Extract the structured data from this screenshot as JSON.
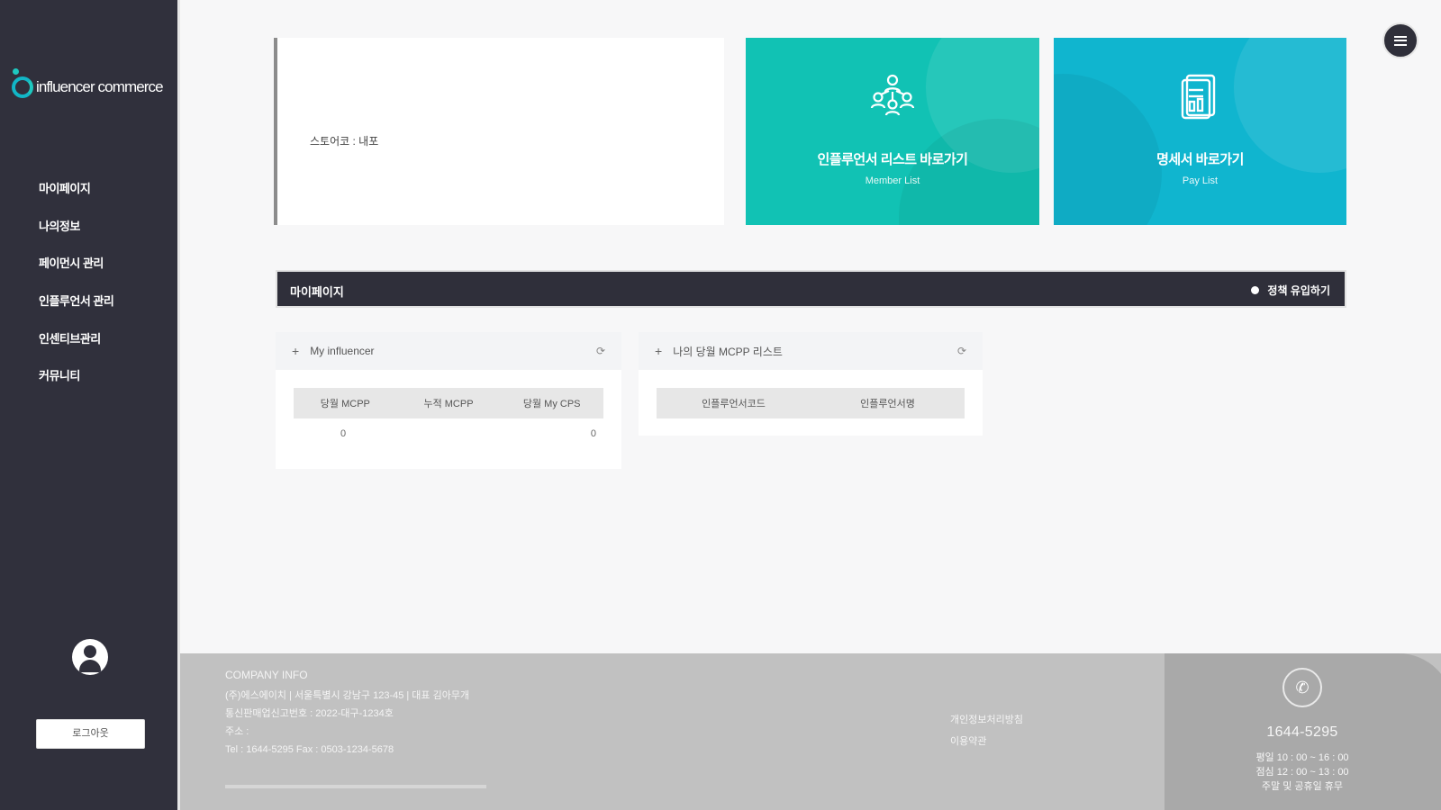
{
  "brand": {
    "logo_text": "influencer commerce"
  },
  "sidebar": {
    "items": [
      {
        "label": "마이페이지"
      },
      {
        "label": "나의정보"
      },
      {
        "label": "페이먼시 관리"
      },
      {
        "label": "인플루언서 관리"
      },
      {
        "label": "인센티브관리"
      },
      {
        "label": "커뮤니티"
      }
    ],
    "logout_label": "로그아웃"
  },
  "header": {
    "menu_icon": "hamburger-icon"
  },
  "info_card": {
    "status_text": "스토어코 : 내포"
  },
  "cards": {
    "member": {
      "title": "인플루언서 리스트 바로가기",
      "subtitle": "Member List",
      "icon": "people-network-icon",
      "color": "#11c2b4"
    },
    "pay": {
      "title": "명세서 바로가기",
      "subtitle": "Pay List",
      "icon": "document-icon",
      "color": "#10b5cf"
    }
  },
  "dashboard": {
    "label": "마이페이지",
    "action_label": "정책 유입하기"
  },
  "panel_my_influencer": {
    "title": "My influencer",
    "columns": [
      "당월 MCPP",
      "누적 MCPP",
      "당월 My CPS"
    ],
    "values": [
      "0",
      "0"
    ]
  },
  "panel_mcpp_list": {
    "title": "나의 당월 MCPP 리스트",
    "columns": [
      "인플루언서코드",
      "인플루언서명"
    ]
  },
  "footer": {
    "company_heading": "COMPANY INFO",
    "company_lines": [
      "(주)에스에이치 | 서울특별시 강남구 123-45 | 대표 김아무개",
      "통신판매업신고번호 : 2022-대구-1234호",
      "주소 :",
      "Tel : 1644-5295   Fax : 0503-1234-5678"
    ],
    "links": [
      "개인정보처리방침",
      "이용약관"
    ],
    "cs_phone": "1644-5295",
    "cs_hours": [
      "평일 10 : 00 ~ 16 : 00",
      "점심 12 : 00 ~ 13 : 00",
      "주말 및 공휴일 휴무"
    ]
  }
}
